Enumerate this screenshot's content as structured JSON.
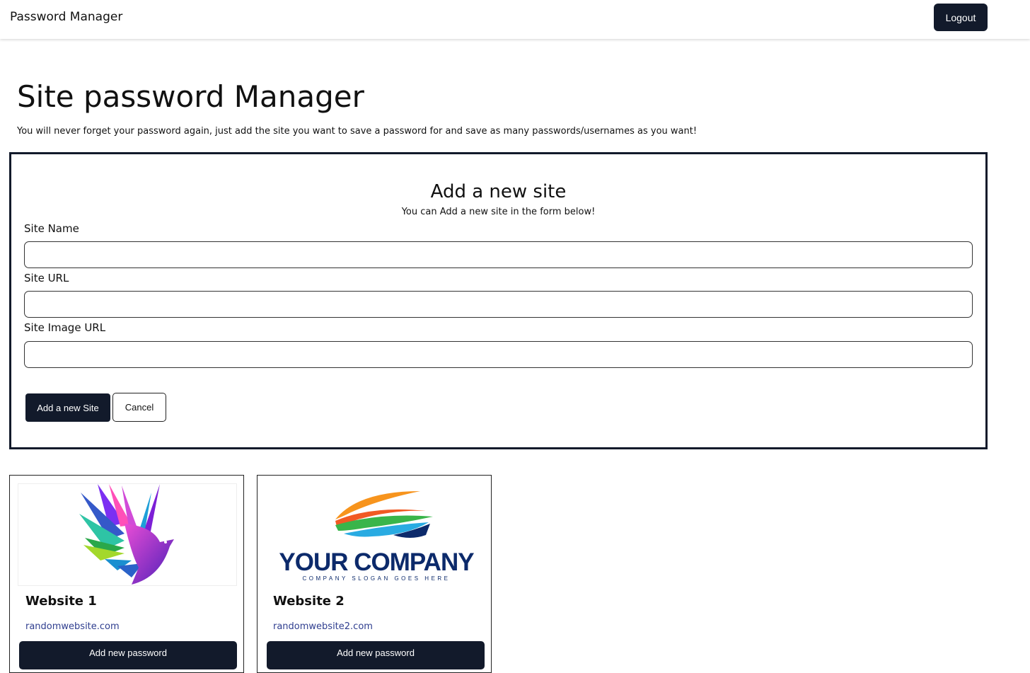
{
  "navbar": {
    "brand": "Password Manager",
    "logout_label": "Logout"
  },
  "header": {
    "title": "Site password Manager",
    "subtitle": "You will never forget your password again, just add the site you want to save a password for and save as many passwords/usernames as you want!"
  },
  "form": {
    "title": "Add a new site",
    "subtitle": "You can Add a new site in the form below!",
    "fields": [
      {
        "label": "Site Name",
        "value": ""
      },
      {
        "label": "Site URL",
        "value": ""
      },
      {
        "label": "Site Image URL",
        "value": ""
      }
    ],
    "submit_label": "Add a new Site",
    "cancel_label": "Cancel"
  },
  "sites": [
    {
      "name": "Website 1",
      "url": "randomwebsite.com",
      "image": "bird-logo",
      "button_label": "Add new password"
    },
    {
      "name": "Website 2",
      "url": "randomwebsite2.com",
      "image": "company-logo",
      "logo_text": "YOUR COMPANY",
      "logo_slogan": "COMPANY SLOGAN GOES HERE",
      "button_label": "Add new password"
    }
  ],
  "colors": {
    "primary": "#121a2b",
    "link": "#2f3e8f",
    "logo_navy": "#0c2a6b"
  }
}
